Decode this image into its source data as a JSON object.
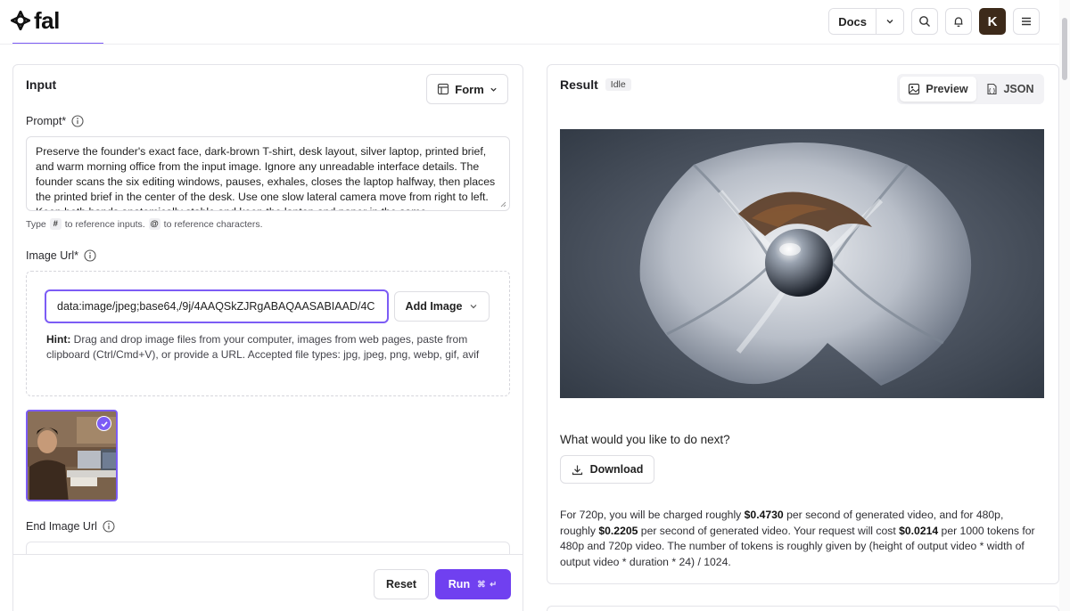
{
  "header": {
    "logo_text": "fal",
    "docs_label": "Docs",
    "avatar_letter": "K"
  },
  "input_panel": {
    "title": "Input",
    "form_button": "Form",
    "prompt": {
      "label": "Prompt*",
      "value": "Preserve the founder's exact face, dark-brown T-shirt, desk layout, silver laptop, printed brief, and warm morning office from the input image. Ignore any unreadable interface details. The founder scans the six editing windows, pauses, exhales, closes the laptop halfway, then places the printed brief in the center of the desk. Use one slow lateral camera move from right to left. Keep both hands anatomically stable and keep the laptop and paper in the same",
      "hint_type": "Type",
      "hint_hash_key": "#",
      "hint_mid": "to reference inputs.",
      "hint_at_key": "@",
      "hint_end": "to reference characters."
    },
    "image_url": {
      "label": "Image Url*",
      "value": "data:image/jpeg;base64,/9j/4AAQSkZJRgABAQAASABIAAD/4C",
      "add_image_button": "Add Image",
      "hint_label": "Hint:",
      "hint_text": "Drag and drop image files from your computer, images from web pages, paste from clipboard (Ctrl/Cmd+V), or provide a URL. Accepted file types: jpg, jpeg, png, webp, gif, avif"
    },
    "end_image_url": {
      "label": "End Image Url"
    },
    "reset_button": "Reset",
    "run_button": "Run",
    "run_shortcut": "⌘ ↵"
  },
  "result_panel": {
    "title": "Result",
    "status": "Idle",
    "view_preview": "Preview",
    "view_json": "JSON",
    "next_title": "What would you like to do next?",
    "download_button": "Download",
    "pricing": {
      "t1": "For 720p, you will be charged roughly ",
      "p1": "$0.4730",
      "t2": " per second of generated video, and for 480p, roughly ",
      "p2": "$0.2205",
      "t3": " per second of generated video. Your request will cost ",
      "p3": "$0.0214",
      "t4": " per 1000 tokens for 480p and 720p video. The number of tokens is roughly given by (height of output video * width of output video * duration * 24) / 1024."
    }
  },
  "colors": {
    "accent": "#7c5cf5",
    "run_button": "#7040f0",
    "border": "#dedee3"
  },
  "icons": [
    "fal-logo-icon",
    "chevron-down-icon",
    "search-icon",
    "bell-icon",
    "menu-icon",
    "form-layout-icon",
    "info-icon",
    "check-icon",
    "image-icon",
    "json-file-icon",
    "download-icon"
  ]
}
